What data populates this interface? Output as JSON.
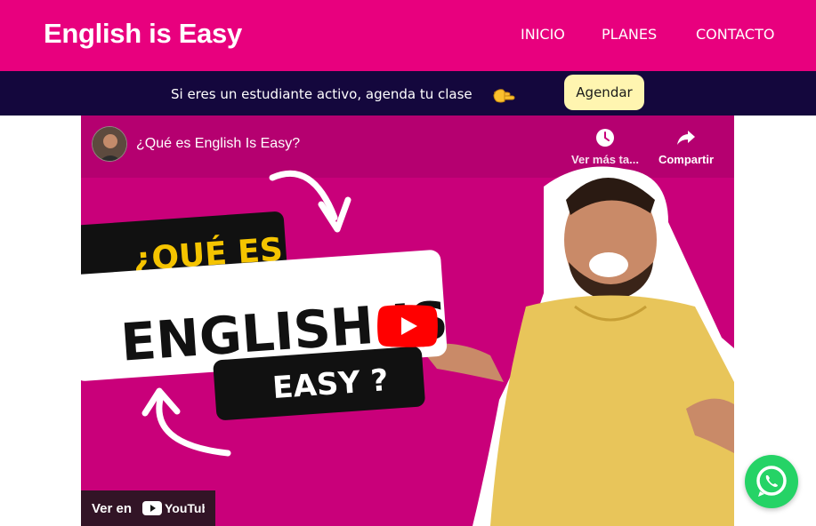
{
  "header": {
    "brand": "English is Easy",
    "nav": [
      {
        "label": "INICIO"
      },
      {
        "label": "PLANES"
      },
      {
        "label": "CONTACTO"
      }
    ],
    "bg_color": "#e8007e"
  },
  "promo_bar": {
    "text": "Si eres un estudiante activo, agenda tu clase",
    "pointer_icon": "pointing-hand-icon",
    "button_label": "Agendar",
    "bg_color": "#14073d",
    "button_color": "#fff5b0"
  },
  "video": {
    "title": "¿Qué es English Is Easy?",
    "watch_later_label": "Ver más ta...",
    "share_label": "Compartir",
    "thumbnail_text": [
      "¿QUÉ ES",
      "ENGLISH IS",
      "EASY ?"
    ],
    "watch_on_label": "Ver en",
    "platform_label": "YouTube",
    "play_icon": "youtube-play-icon",
    "bg_color": "#c9007a"
  },
  "floating": {
    "icon": "whatsapp-icon",
    "color": "#25d366"
  }
}
